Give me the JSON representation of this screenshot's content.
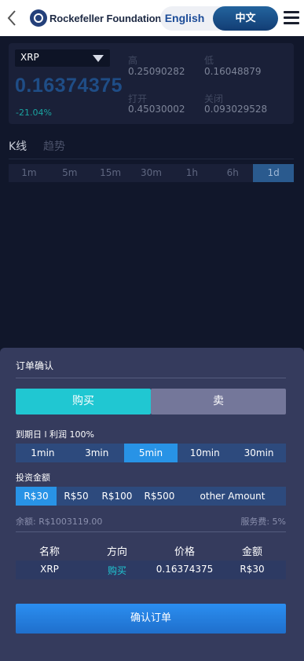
{
  "header": {
    "brand_name": "Rockefeller Foundation",
    "lang_en": "English",
    "lang_cn": "中文",
    "icons": [
      "back-chevron-icon",
      "logo-icon",
      "hamburger-menu-icon"
    ]
  },
  "ticker": {
    "symbol": "XRP",
    "price": "0.16374375",
    "change": "-21.04%",
    "high_label": "高",
    "high_value": "0.25090282",
    "low_label": "低",
    "low_value": "0.16048879",
    "open_label": "打开",
    "open_value": "0.45030002",
    "close_label": "关闭",
    "close_value": "0.093029528"
  },
  "chart_tabs": {
    "kline": "K线",
    "trend": "趋势",
    "timeframes": [
      "1m",
      "5m",
      "15m",
      "30m",
      "1h",
      "6h",
      "1d"
    ],
    "active_timeframe": "1d"
  },
  "order": {
    "title": "订单确认",
    "buy_label": "购买",
    "sell_label": "卖",
    "period_label": "到期日 l 利润 100%",
    "periods": [
      "1min",
      "3min",
      "5min",
      "10min",
      "30min"
    ],
    "active_period": "5min",
    "amount_label": "投资金额",
    "amounts": [
      "R$30",
      "R$50",
      "R$100",
      "R$500",
      "other Amount"
    ],
    "active_amount": "R$30",
    "balance": "余额: R$1003119.00",
    "fee": "服务费: 5%",
    "table": {
      "headers": [
        "名称",
        "方向",
        "价格",
        "金额"
      ],
      "row": [
        "XRP",
        "购买",
        "0.16374375",
        "R$30"
      ]
    },
    "confirm_label": "确认订单"
  },
  "colors": {
    "accent_buy": "#20c7d2",
    "accent_blue": "#2893e6",
    "sheet_bg": "#353b5d",
    "page_bg": "#11172b"
  }
}
